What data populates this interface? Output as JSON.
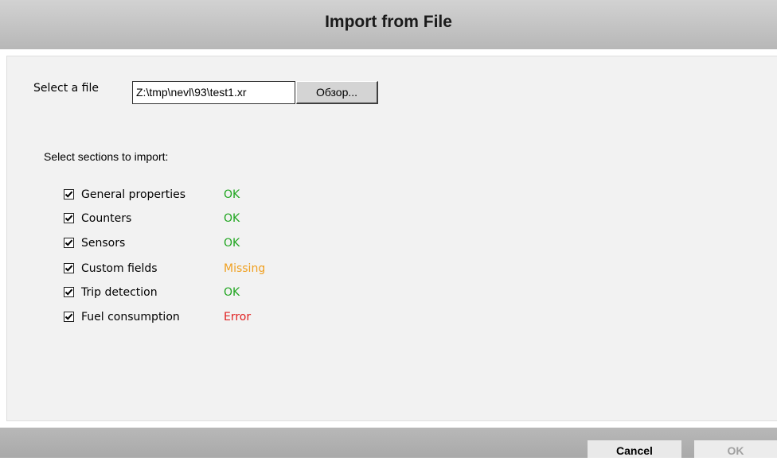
{
  "dialog": {
    "title": "Import from File"
  },
  "file": {
    "label": "Select a file",
    "value": "Z:\\tmp\\nevl\\93\\test1.xr",
    "browse_label": "Обзор..."
  },
  "sections": {
    "heading": "Select sections to import:",
    "items": [
      {
        "label": "General properties",
        "checked": true,
        "status": "OK",
        "status_color": "#1fa51f"
      },
      {
        "label": "Counters",
        "checked": true,
        "status": "OK",
        "status_color": "#1fa51f"
      },
      {
        "label": "Sensors",
        "checked": true,
        "status": "OK",
        "status_color": "#1fa51f"
      },
      {
        "label": "Custom fields",
        "checked": true,
        "status": "Missing",
        "status_color": "#f0a020"
      },
      {
        "label": "Trip detection",
        "checked": true,
        "status": "OK",
        "status_color": "#1fa51f"
      },
      {
        "label": "Fuel consumption",
        "checked": true,
        "status": "Error",
        "status_color": "#e02020"
      }
    ]
  },
  "buttons": {
    "cancel_label": "Cancel",
    "ok_label": "OK",
    "ok_enabled": false
  }
}
